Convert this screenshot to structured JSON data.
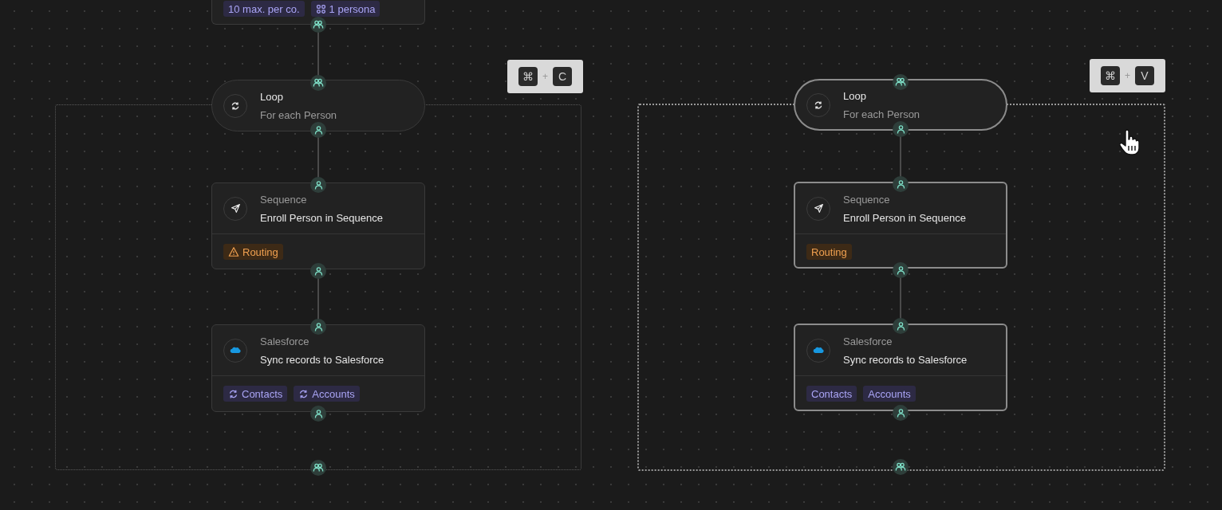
{
  "panels": [
    {
      "selected": false,
      "shortcut": {
        "modifier": "⌘",
        "plus": "+",
        "key": "C"
      },
      "nodes": [
        {
          "kind": "summary",
          "tags": [
            {
              "label": "10 max. per co.",
              "kind": "limit"
            },
            {
              "label": "1 persona",
              "kind": "persona"
            }
          ]
        },
        {
          "kind": "loop",
          "title": "Loop",
          "subtitle": "For each Person"
        },
        {
          "kind": "sequence",
          "app": "Sequence",
          "action": "Enroll Person in Sequence",
          "tags": [
            {
              "label": "Routing",
              "kind": "alert"
            }
          ]
        },
        {
          "kind": "salesforce",
          "app": "Salesforce",
          "action": "Sync records to Salesforce",
          "tags": [
            {
              "label": "Contacts",
              "kind": "sync"
            },
            {
              "label": "Accounts",
              "kind": "sync"
            }
          ]
        }
      ]
    },
    {
      "selected": true,
      "shortcut": {
        "modifier": "⌘",
        "plus": "+",
        "key": "V"
      },
      "nodes": [
        {
          "kind": "loop",
          "title": "Loop",
          "subtitle": "For each Person"
        },
        {
          "kind": "sequence",
          "app": "Sequence",
          "action": "Enroll Person in Sequence",
          "tags": [
            {
              "label": "Routing",
              "kind": "routing"
            }
          ]
        },
        {
          "kind": "salesforce",
          "app": "Salesforce",
          "action": "Sync records to Salesforce",
          "tags": [
            {
              "label": "Contacts",
              "kind": "object"
            },
            {
              "label": "Accounts",
              "kind": "object"
            }
          ]
        }
      ]
    }
  ]
}
